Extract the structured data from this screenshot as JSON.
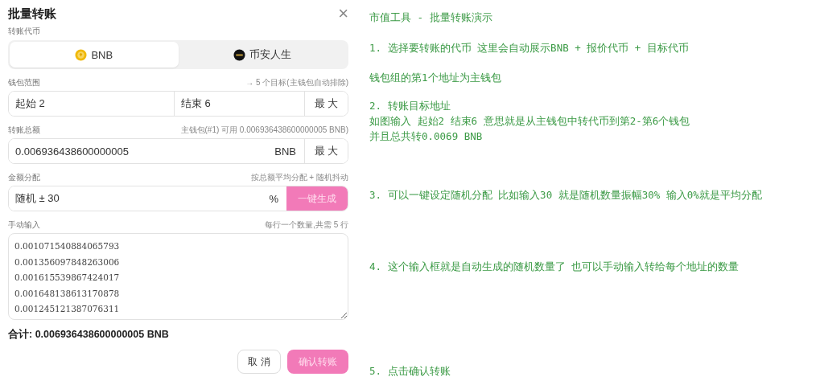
{
  "dialog": {
    "title": "批量转账",
    "close": "×",
    "token_section": {
      "label": "转账代币",
      "options": [
        {
          "label": "BNB",
          "selected": true
        },
        {
          "label": "币安人生",
          "selected": false
        }
      ]
    },
    "wallet_range": {
      "label": "钱包范围",
      "hint": "→ 5 个目标(主钱包自动排除)",
      "start": "起始 2",
      "end": "结束 6",
      "max_button": "最 大"
    },
    "total": {
      "label": "转账总额",
      "hint": "主钱包(#1) 可用 0.006936438600000005 BNB)",
      "value": "0.006936438600000005",
      "unit": "BNB",
      "max_button": "最 大"
    },
    "distribution": {
      "label": "金额分配",
      "hint": "按总额平均分配 + 随机抖动",
      "value": "随机 ± 30",
      "unit": "%",
      "generate_button": "一键生成"
    },
    "manual_input": {
      "label": "手动输入",
      "hint": "每行一个数量,共需 5 行",
      "lines": [
        "0.001071540884065793",
        "0.001356097848263006",
        "0.001615539867424017",
        "0.001648138613170878",
        "0.001245121387076311"
      ]
    },
    "sum": "合计: 0.006936438600000005 BNB",
    "buttons": [
      {
        "label": "取 消",
        "kind": "secondary"
      },
      {
        "label": "确认转账",
        "kind": "primary"
      }
    ]
  },
  "notes": [
    {
      "lines": [
        "市值工具 - 批量转账演示"
      ]
    },
    {
      "lines": [
        "1. 选择要转账的代币 这里会自动展示BNB + 报价代币 + 目标代币"
      ]
    },
    {
      "lines": [
        "钱包组的第1个地址为主钱包"
      ]
    },
    {
      "lines": [
        "2. 转账目标地址",
        "如图输入 起始2 结束6 意思就是从主钱包中转代币到第2-第6个钱包",
        "并且总共转0.0069 BNB"
      ]
    },
    {
      "lines": [
        "3. 可以一键设定随机分配 比如输入30 就是随机数量振幅30% 输入0%就是平均分配"
      ]
    },
    {
      "lines": [
        "4. 这个输入框就是自动生成的随机数量了 也可以手动输入转给每个地址的数量"
      ]
    },
    {
      "lines": [
        "5. 点击确认转账"
      ]
    }
  ]
}
